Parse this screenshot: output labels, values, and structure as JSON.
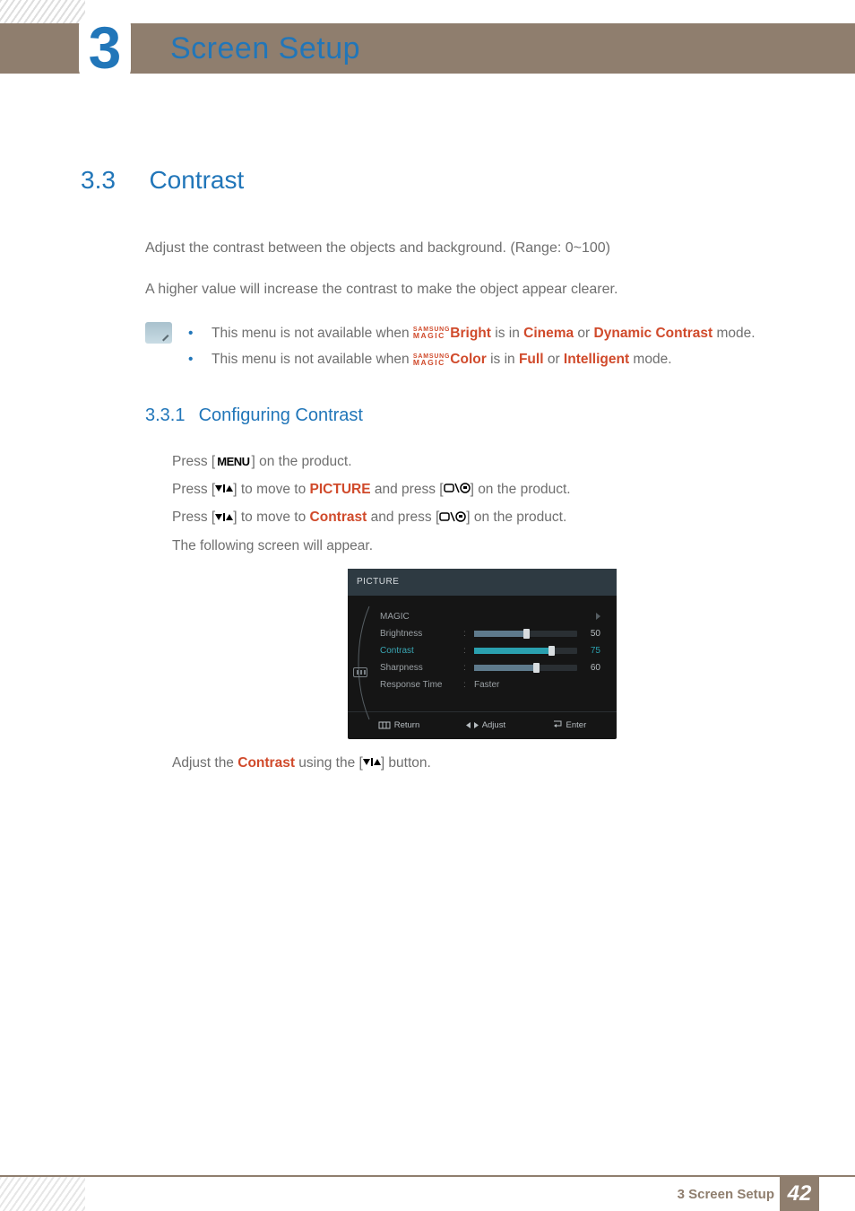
{
  "chapter": {
    "number": "3",
    "title": "Screen Setup"
  },
  "section": {
    "number": "3.3",
    "title": "Contrast"
  },
  "intro": {
    "p1": "Adjust the contrast between the objects and background. (Range: 0~100)",
    "p2": "A higher value will increase the contrast to make the object appear clearer."
  },
  "magic": {
    "top": "SAMSUNG",
    "bottom": "MAGIC"
  },
  "notes": {
    "n1_a": "This menu is not available when ",
    "n1_word": "Bright",
    "n1_b": " is in ",
    "n1_c": "Cinema",
    "n1_d": " or ",
    "n1_e": "Dynamic Contrast",
    "n1_f": " mode.",
    "n2_a": "This menu is not available when ",
    "n2_word": "Color",
    "n2_b": " is in ",
    "n2_c": "Full",
    "n2_d": " or ",
    "n2_e": "Intelligent",
    "n2_f": " mode."
  },
  "subsection": {
    "number": "3.3.1",
    "title": "Configuring Contrast"
  },
  "steps": {
    "s1_a": "Press [",
    "s1_menu": "MENU",
    "s1_b": "] on the product.",
    "s2_a": "Press [",
    "s2_b": "] to move to ",
    "s2_c": "PICTURE",
    "s2_d": " and press [",
    "s2_e": "] on the product.",
    "s3_a": "Press [",
    "s3_b": "] to move to ",
    "s3_c": "Contrast",
    "s3_d": " and press [",
    "s3_e": "] on the product.",
    "s4": "The following screen will appear."
  },
  "osd": {
    "header": "PICTURE",
    "items": {
      "magic": "MAGIC",
      "brightness": "Brightness",
      "contrast": "Contrast",
      "sharpness": "Sharpness",
      "response": "Response Time"
    },
    "values": {
      "brightness": "50",
      "contrast": "75",
      "sharpness": "60",
      "response": "Faster"
    },
    "bars": {
      "brightness_pct": 50,
      "contrast_pct": 75,
      "sharpness_pct": 60
    },
    "footer": {
      "return": "Return",
      "adjust": "Adjust",
      "enter": "Enter"
    }
  },
  "post_osd": {
    "a": "Adjust the ",
    "b": "Contrast",
    "c": " using the [",
    "d": "] button."
  },
  "footer": {
    "label": "3 Screen Setup",
    "page": "42"
  }
}
